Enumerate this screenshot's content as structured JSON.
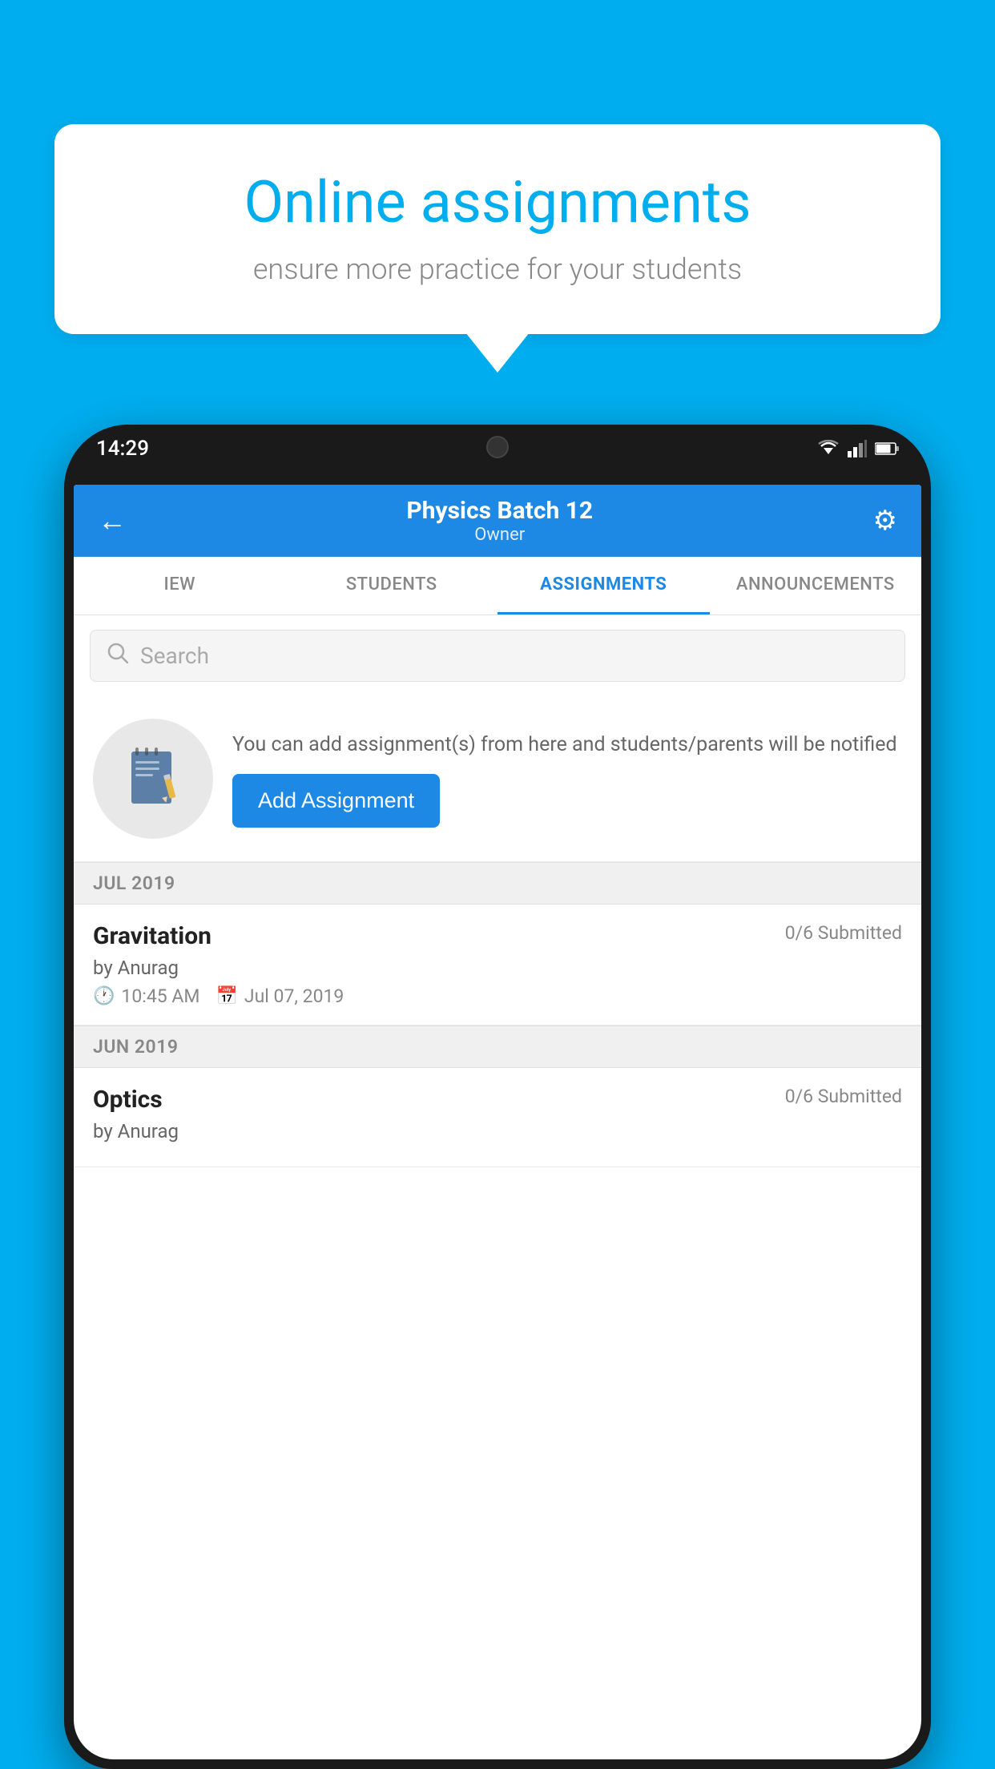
{
  "background_color": "#00AEEF",
  "speech_bubble": {
    "title": "Online assignments",
    "subtitle": "ensure more practice for your students"
  },
  "status_bar": {
    "time": "14:29"
  },
  "app_header": {
    "title": "Physics Batch 12",
    "subtitle": "Owner",
    "back_label": "←",
    "gear_label": "⚙"
  },
  "tabs": [
    {
      "label": "IEW",
      "active": false
    },
    {
      "label": "STUDENTS",
      "active": false
    },
    {
      "label": "ASSIGNMENTS",
      "active": true
    },
    {
      "label": "ANNOUNCEMENTS",
      "active": false
    }
  ],
  "search": {
    "placeholder": "Search"
  },
  "add_assignment_section": {
    "description": "You can add assignment(s) from here and students/parents will be notified",
    "button_label": "Add Assignment"
  },
  "assignment_groups": [
    {
      "month": "JUL 2019",
      "assignments": [
        {
          "name": "Gravitation",
          "submitted": "0/6 Submitted",
          "by": "by Anurag",
          "time": "10:45 AM",
          "date": "Jul 07, 2019"
        }
      ]
    },
    {
      "month": "JUN 2019",
      "assignments": [
        {
          "name": "Optics",
          "submitted": "0/6 Submitted",
          "by": "by Anurag",
          "time": "",
          "date": ""
        }
      ]
    }
  ]
}
